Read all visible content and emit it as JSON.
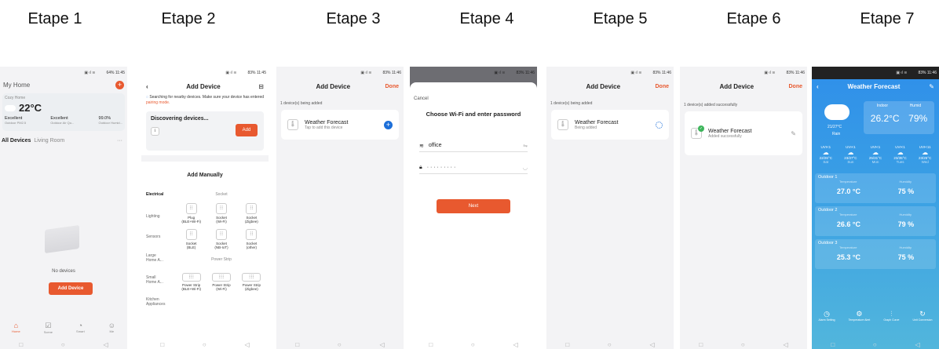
{
  "steps": [
    "Etape 1",
    "Etape 2",
    "Etape 3",
    "Etape 4",
    "Etape 5",
    "Etape 6",
    "Etape 7"
  ],
  "s1": {
    "status": "64% 11:45",
    "home": "My Home",
    "cozy": "Cozy Home",
    "temp": "22°C",
    "q1": "Excellent",
    "q1s": "Outdoor PM2.5",
    "q2": "Excellent",
    "q2s": "Outdoor Air Qu...",
    "q3": "99.0%",
    "q3s": "Outdoor Humid...",
    "tab_all": "All Devices",
    "tab_living": "Living Room",
    "empty": "No devices",
    "add": "Add Device",
    "nav": [
      "Home",
      "Scene",
      "Smart",
      "Me"
    ]
  },
  "s2": {
    "status": "83% 11:45",
    "title": "Add Device",
    "search": "Searching for nearby devices. Make sure your device has entered",
    "pair": "pairing mode.",
    "disc": "Discovering devices...",
    "add": "Add",
    "manual": "Add Manually",
    "cats": [
      "Electrical",
      "Lighting",
      "Sensors",
      "Large Home A...",
      "Small Home A...",
      "Kitchen Appliances"
    ],
    "socket": "Socket",
    "strip": "Power Strip",
    "devices": [
      {
        "n": "Plug\n(BLE+Wi-Fi)"
      },
      {
        "n": "Socket\n(Wi-Fi)"
      },
      {
        "n": "Socket\n(Zigbee)"
      },
      {
        "n": "Socket\n(BLE)"
      },
      {
        "n": "Socket\n(NB-IoT)"
      },
      {
        "n": "Socket\n(other)"
      }
    ],
    "strips": [
      "Power Strip\n(BLE+Wi-Fi)",
      "Power Strip\n(Wi-Fi)",
      "Power Strip\n(Zigbee)"
    ]
  },
  "s3": {
    "status": "83% 11:46",
    "title": "Add Device",
    "done": "Done",
    "being": "1 device(s) being added",
    "dev": "Weather Forecast",
    "sub": "Tap to add this device"
  },
  "s4": {
    "status": "83% 11:46",
    "cancel": "Cancel",
    "title": "Choose Wi-Fi and enter password",
    "ssid": "office",
    "pwd": "· · · · · · · · ·",
    "next": "Next"
  },
  "s5": {
    "status": "83% 11:46",
    "title": "Add Device",
    "done": "Done",
    "being": "1 device(s) being added",
    "dev": "Weather Forecast",
    "sub": "Being added"
  },
  "s6": {
    "status": "83% 11:46",
    "title": "Add Device",
    "done": "Done",
    "ok": "1 device(s) added successfully",
    "dev": "Weather Forecast",
    "sub": "Added successfully"
  },
  "s7": {
    "status": "83% 11:46",
    "title": "Weather Forecast",
    "range": "21/27°C",
    "cond": "Rain",
    "indoor": "Indoor",
    "humid": "Humid",
    "in_t": "26.2°C",
    "in_h": "79%",
    "uvi": [
      "UVI<1",
      "UVI<1",
      "UVI<1",
      "UVI<1",
      "UVI<11"
    ],
    "days": [
      {
        "t": "22/26°C",
        "d": "Sat"
      },
      {
        "t": "23/27°C",
        "d": "Sun"
      },
      {
        "t": "25/31°C",
        "d": "Mon"
      },
      {
        "t": "23/35°C",
        "d": "Tues"
      },
      {
        "t": "23/25°C",
        "d": "Wed"
      }
    ],
    "outdoors": [
      {
        "n": "Outdoor 1",
        "t": "27.0 °C",
        "h": "75 %"
      },
      {
        "n": "Outdoor 2",
        "t": "26.6 °C",
        "h": "79 %"
      },
      {
        "n": "Outdoor 3",
        "t": "25.3 °C",
        "h": "75 %"
      }
    ],
    "tl": "Temperature",
    "hl": "Humidity",
    "bottom": [
      "Alarm Setting",
      "Temperature Alert",
      "Graph Curve",
      "Unit Conversion"
    ]
  },
  "colors": {
    "accent": "#e8592f",
    "blue": "#1d6fd9",
    "weather_top": "#2f8fea",
    "weather_bottom": "#52b6dc"
  }
}
